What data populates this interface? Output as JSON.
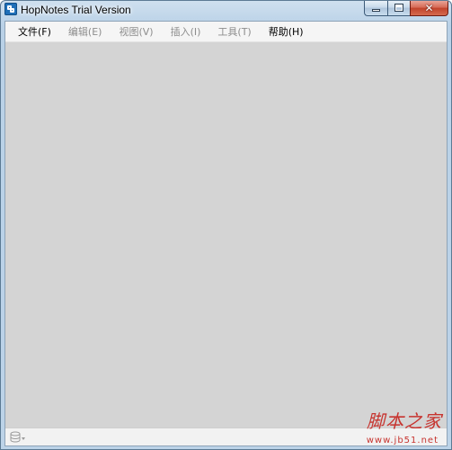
{
  "window": {
    "title": "HopNotes Trial Version",
    "icon": "hopnotes-app-icon",
    "controls": {
      "minimize_icon": "minimize-icon",
      "maximize_icon": "maximize-icon",
      "close_glyph": "✕"
    }
  },
  "menubar": {
    "items": [
      {
        "label": "文件(F)",
        "enabled": true
      },
      {
        "label": "编辑(E)",
        "enabled": false
      },
      {
        "label": "视图(V)",
        "enabled": false
      },
      {
        "label": "插入(I)",
        "enabled": false
      },
      {
        "label": "工具(T)",
        "enabled": false
      },
      {
        "label": "帮助(H)",
        "enabled": true
      }
    ]
  },
  "statusbar": {
    "icon": "database-sync-icon"
  },
  "watermark": {
    "chinese": "脚本之家",
    "url": "www.jb51.net"
  },
  "colors": {
    "workspace": "#d4d4d4",
    "menu_enabled": "#000000",
    "menu_disabled": "#8d8d8d",
    "watermark": "#c7342f",
    "frame": "#b9d1e7"
  }
}
